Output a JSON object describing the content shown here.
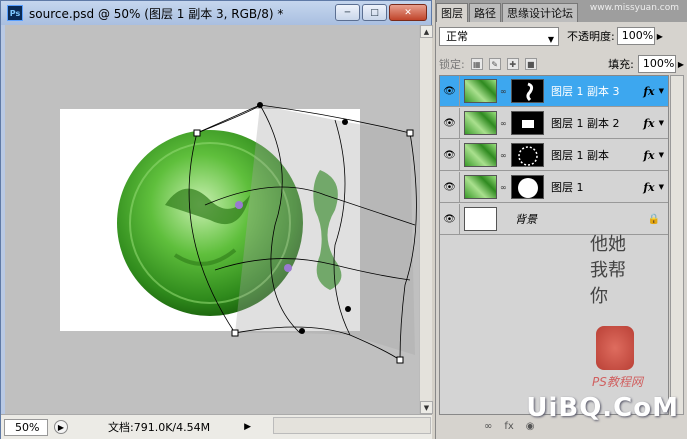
{
  "document": {
    "title": "source.psd @ 50% (图层 1 副本 3, RGB/8) *",
    "app_icon": "Ps",
    "zoom": "50%",
    "doc_info": "文档:791.0K/4.54M"
  },
  "panel": {
    "tabs": [
      "图层",
      "路径",
      "思缘设计论坛"
    ],
    "watermark_top": "www.missyuan.com",
    "blend_mode": "正常",
    "opacity_label": "不透明度:",
    "opacity_value": "100%",
    "lock_label": "锁定:",
    "fill_label": "填充:",
    "fill_value": "100%",
    "layers": [
      {
        "name": "图层 1 副本 3",
        "selected": true,
        "has_mask": true,
        "fx": "fx"
      },
      {
        "name": "图层 1 副本 2",
        "selected": false,
        "has_mask": true,
        "fx": "fx"
      },
      {
        "name": "图层 1 副本",
        "selected": false,
        "has_mask": true,
        "fx": "fx"
      },
      {
        "name": "图层 1",
        "selected": false,
        "has_mask": true,
        "fx": "fx"
      },
      {
        "name": "背景",
        "selected": false,
        "has_mask": false,
        "fx": ""
      }
    ]
  },
  "watermark_bottom": "UiBQ.CoM",
  "signature": "他她我帮你",
  "ps_tutorial": "PS教程网",
  "colors": {
    "selection": "#3da7ef",
    "jade": "#3a9a2a",
    "canvas": "#c0c0c0"
  }
}
